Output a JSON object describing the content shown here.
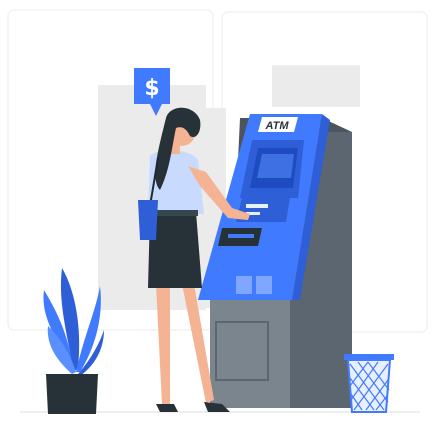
{
  "illustration": {
    "atm_sign": "ATM",
    "speech_bubble_symbol": "$"
  },
  "colors": {
    "accent_blue": "#407BFF",
    "accent_blue_dark": "#2F5FD6",
    "atm_body_dark": "#4A5560",
    "atm_body_mid": "#5C6670",
    "atm_body_light": "#7B858E",
    "skin": "#F4B493",
    "hair": "#263238",
    "skirt": "#263238",
    "shirt": "#C8DBFF",
    "backdrop": "#EBEBEB",
    "plant_pot": "#263238",
    "wall_outline": "#F3F3F3"
  }
}
